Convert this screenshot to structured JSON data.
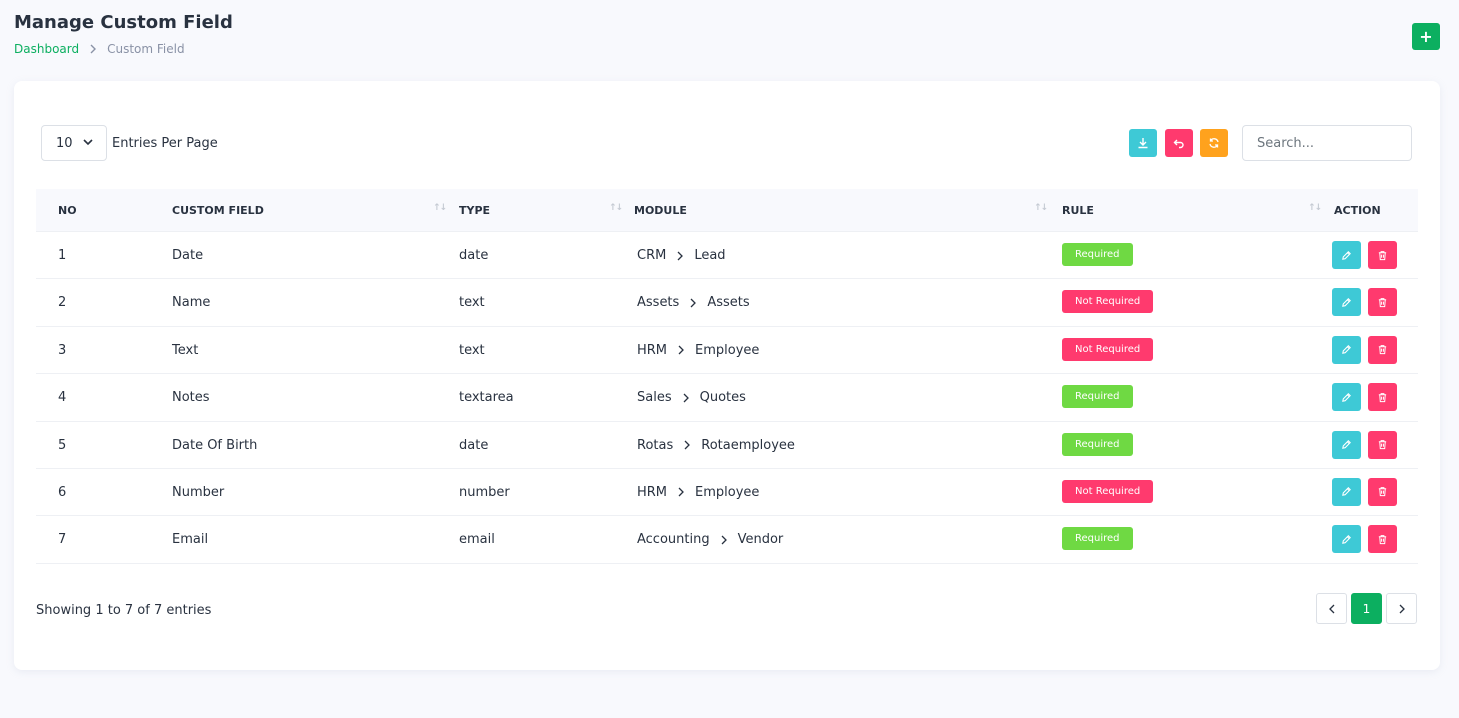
{
  "page": {
    "title": "Manage Custom Field",
    "breadcrumb": {
      "home": "Dashboard",
      "current": "Custom Field"
    },
    "add_button": "+"
  },
  "controls": {
    "entries_value": "10",
    "entries_label": "Entries Per Page",
    "search_placeholder": "Search..."
  },
  "table": {
    "headers": {
      "no": "NO",
      "custom_field": "CUSTOM FIELD",
      "type": "TYPE",
      "module": "MODULE",
      "rule": "RULE",
      "action": "ACTION"
    },
    "rows": [
      {
        "no": "1",
        "field": "Date",
        "type": "date",
        "module": "CRM",
        "submodule": "Lead",
        "rule": "Required"
      },
      {
        "no": "2",
        "field": "Name",
        "type": "text",
        "module": "Assets",
        "submodule": "Assets",
        "rule": "Not Required"
      },
      {
        "no": "3",
        "field": "Text",
        "type": "text",
        "module": "HRM",
        "submodule": "Employee",
        "rule": "Not Required"
      },
      {
        "no": "4",
        "field": "Notes",
        "type": "textarea",
        "module": "Sales",
        "submodule": "Quotes",
        "rule": "Required"
      },
      {
        "no": "5",
        "field": "Date Of Birth",
        "type": "date",
        "module": "Rotas",
        "submodule": "Rotaemployee",
        "rule": "Required"
      },
      {
        "no": "6",
        "field": "Number",
        "type": "number",
        "module": "HRM",
        "submodule": "Employee",
        "rule": "Not Required"
      },
      {
        "no": "7",
        "field": "Email",
        "type": "email",
        "module": "Accounting",
        "submodule": "Vendor",
        "rule": "Required"
      }
    ]
  },
  "footer": {
    "info": "Showing 1 to 7 of 7 entries",
    "current_page": "1"
  },
  "colors": {
    "primary": "#0CAF60",
    "info": "#3ec9d6",
    "danger": "#ff3a6e",
    "warning": "#ffa21d",
    "success": "#6fd943"
  }
}
